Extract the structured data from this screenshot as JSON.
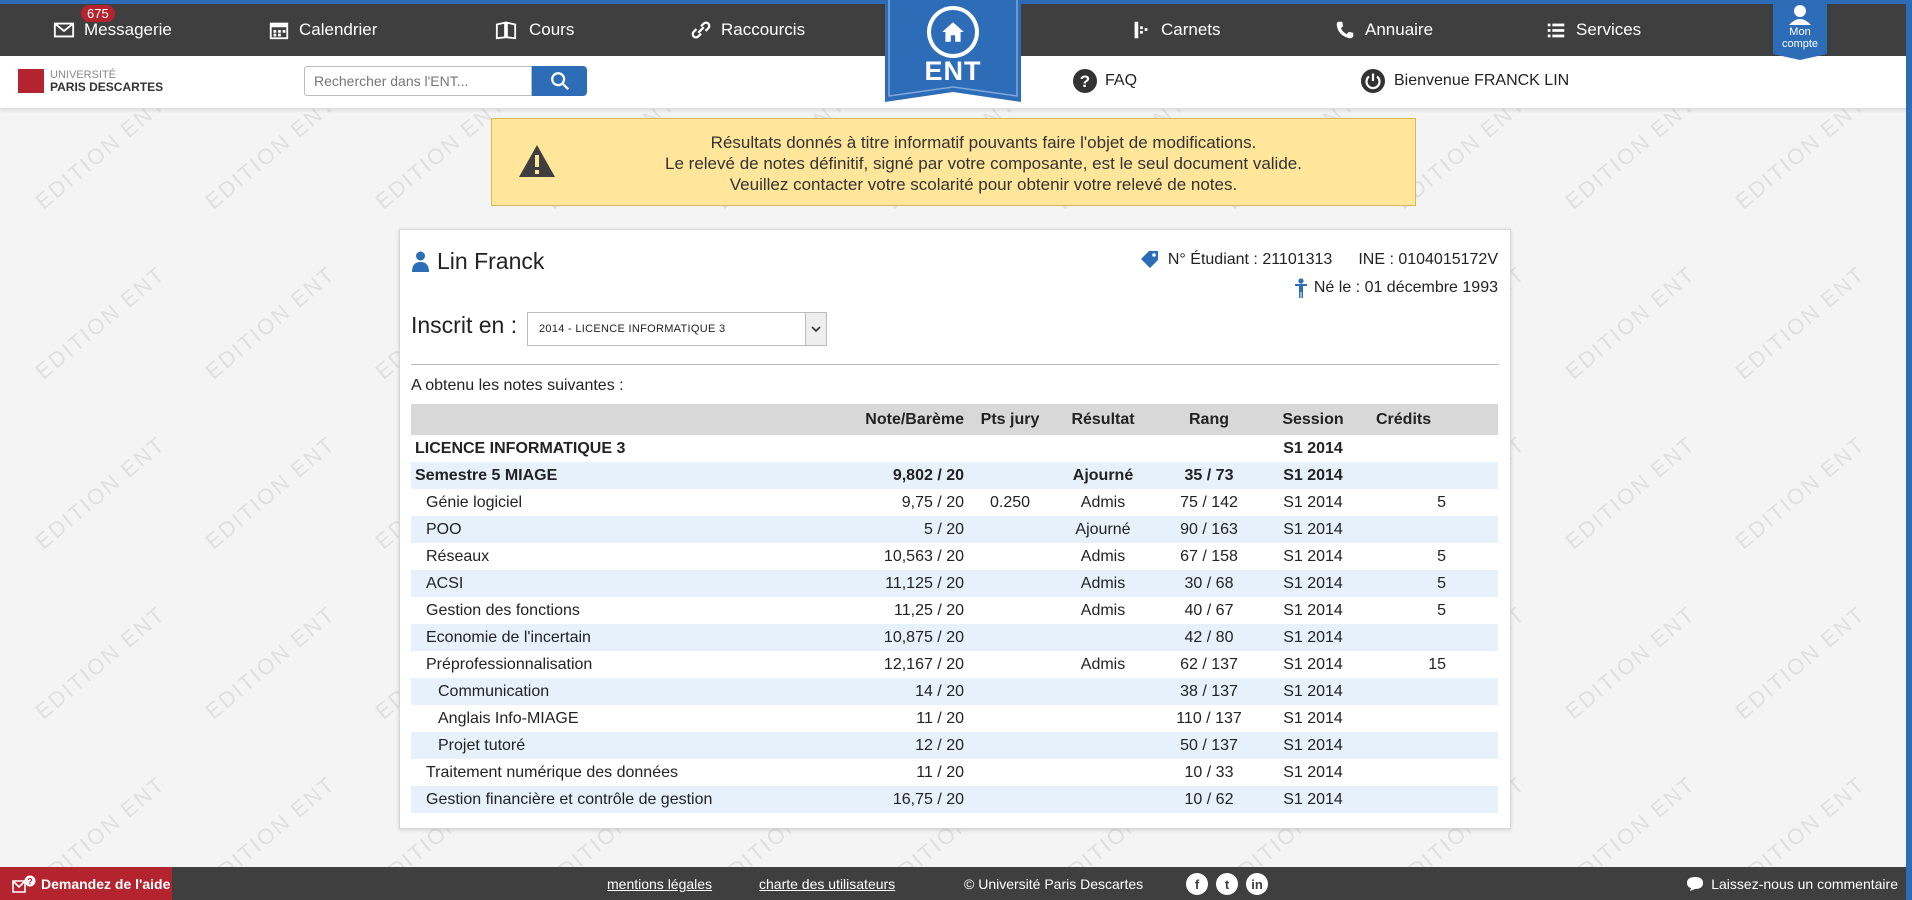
{
  "nav": {
    "messagerie": {
      "label": "Messagerie",
      "badge": "675"
    },
    "calendrier": "Calendrier",
    "cours": "Cours",
    "raccourcis": "Raccourcis",
    "ent": "ENT",
    "carnets": "Carnets",
    "annuaire": "Annuaire",
    "services": "Services",
    "mon_compte": "Mon compte"
  },
  "subbar": {
    "logo_line1": "UNIVERSITÉ",
    "logo_line2": "PARIS DESCARTES",
    "search_placeholder": "Rechercher dans l'ENT...",
    "faq": "FAQ",
    "welcome": "Bienvenue FRANCK LIN"
  },
  "alert": {
    "line1": "Résultats donnés à titre informatif pouvants faire l'objet de modifications.",
    "line2": "Le relevé de notes définitif, signé par votre composante, est le seul document valide.",
    "line3": "Veuillez contacter votre scolarité pour obtenir votre relevé de notes."
  },
  "student": {
    "name": "Lin Franck",
    "num_etudiant": "N° Étudiant : 21101313",
    "ine": "INE : 0104015172V",
    "birth": "Né le : 01 décembre 1993",
    "inscrit_label": "Inscrit en :",
    "inscrit_value": "2014 - LICENCE INFORMATIQUE 3",
    "obtenu": "A obtenu les notes suivantes :"
  },
  "table": {
    "headers": [
      "",
      "Note/Barème",
      "Pts jury",
      "Résultat",
      "Rang",
      "Session",
      "Crédits"
    ],
    "rows": [
      {
        "label": "LICENCE INFORMATIQUE 3",
        "note": "",
        "pts": "",
        "resultat": "",
        "rang": "",
        "session": "S1 2014",
        "credits": ""
      },
      {
        "label": "Semestre 5 MIAGE",
        "note": "9,802 / 20",
        "pts": "",
        "resultat": "Ajourné",
        "rang": "35 / 73",
        "session": "S1 2014",
        "credits": ""
      },
      {
        "label": "Génie logiciel",
        "note": "9,75 / 20",
        "pts": "0.250",
        "resultat": "Admis",
        "rang": "75 / 142",
        "session": "S1 2014",
        "credits": "5"
      },
      {
        "label": "POO",
        "note": "5 / 20",
        "pts": "",
        "resultat": "Ajourné",
        "rang": "90 / 163",
        "session": "S1 2014",
        "credits": ""
      },
      {
        "label": "Réseaux",
        "note": "10,563 / 20",
        "pts": "",
        "resultat": "Admis",
        "rang": "67 / 158",
        "session": "S1 2014",
        "credits": "5"
      },
      {
        "label": "ACSI",
        "note": "11,125 / 20",
        "pts": "",
        "resultat": "Admis",
        "rang": "30 / 68",
        "session": "S1 2014",
        "credits": "5"
      },
      {
        "label": "Gestion des fonctions",
        "note": "11,25 / 20",
        "pts": "",
        "resultat": "Admis",
        "rang": "40 / 67",
        "session": "S1 2014",
        "credits": "5"
      },
      {
        "label": "Economie de l'incertain",
        "note": "10,875 / 20",
        "pts": "",
        "resultat": "",
        "rang": "42 / 80",
        "session": "S1 2014",
        "credits": ""
      },
      {
        "label": "Préprofessionnalisation",
        "note": "12,167 / 20",
        "pts": "",
        "resultat": "Admis",
        "rang": "62 / 137",
        "session": "S1 2014",
        "credits": "15"
      },
      {
        "label": "Communication",
        "note": "14 / 20",
        "pts": "",
        "resultat": "",
        "rang": "38 / 137",
        "session": "S1 2014",
        "credits": ""
      },
      {
        "label": "Anglais Info-MIAGE",
        "note": "11 / 20",
        "pts": "",
        "resultat": "",
        "rang": "110 / 137",
        "session": "S1 2014",
        "credits": ""
      },
      {
        "label": "Projet tutoré",
        "note": "12 / 20",
        "pts": "",
        "resultat": "",
        "rang": "50 / 137",
        "session": "S1 2014",
        "credits": ""
      },
      {
        "label": "Traitement numérique des données",
        "note": "11 / 20",
        "pts": "",
        "resultat": "",
        "rang": "10 / 33",
        "session": "S1 2014",
        "credits": ""
      },
      {
        "label": "Gestion financière et contrôle de gestion",
        "note": "16,75 / 20",
        "pts": "",
        "resultat": "",
        "rang": "10 / 62",
        "session": "S1 2014",
        "credits": ""
      }
    ]
  },
  "footer": {
    "help": "Demandez de l'aide",
    "mentions": "mentions légales",
    "charte": "charte des utilisateurs",
    "copyright": "© Université Paris Descartes",
    "comment": "Laissez-nous un commentaire"
  },
  "watermark_text": "EDITION ENT",
  "colors": {
    "brand_blue": "#2d6db8",
    "brand_red": "#b3242e",
    "bar_dark": "#3f3f3f",
    "alert_bg": "#ffe69a",
    "row_alt": "#e6f1fb"
  }
}
